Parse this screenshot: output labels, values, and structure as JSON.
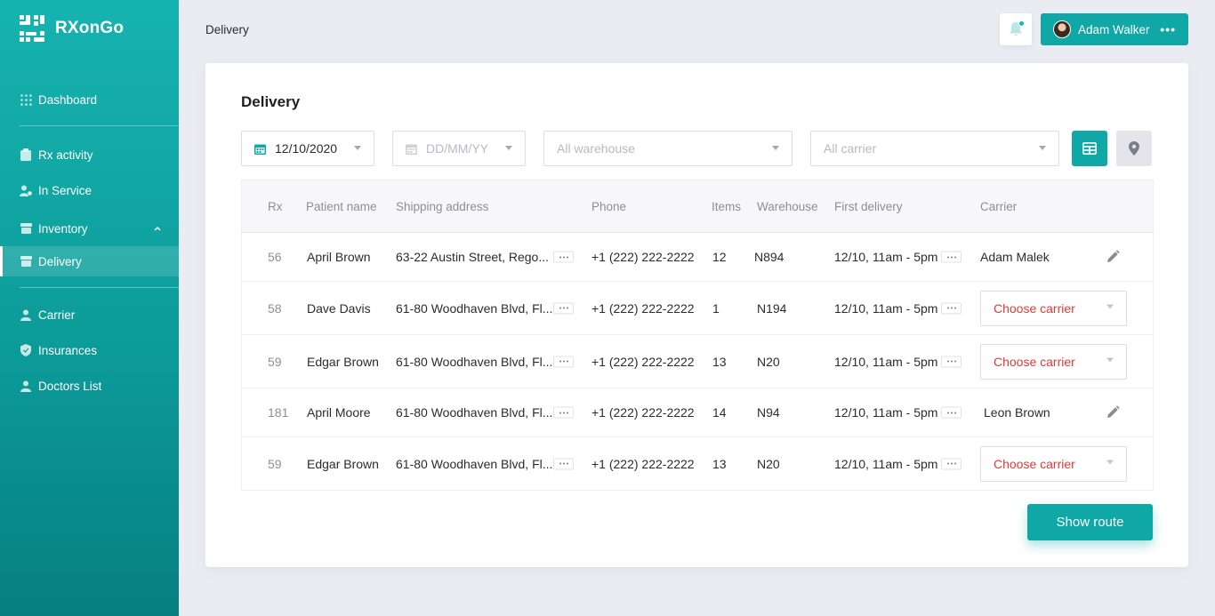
{
  "app": {
    "name": "RXonGo"
  },
  "sidebar": {
    "items": [
      {
        "label": "Dashboard",
        "icon": "grid-icon"
      },
      {
        "label": "Rx activity",
        "icon": "clipboard-icon"
      },
      {
        "label": "In Service",
        "icon": "user-gear-icon"
      },
      {
        "label": "Inventory",
        "icon": "box-icon",
        "expanded": true
      },
      {
        "label": "Delivery",
        "icon": "box-icon",
        "active": true
      },
      {
        "label": "Carrier",
        "icon": "user-icon"
      },
      {
        "label": "Insurances",
        "icon": "shield-icon"
      },
      {
        "label": "Doctors List",
        "icon": "user-icon"
      }
    ]
  },
  "header": {
    "breadcrumb": "Delivery",
    "user": {
      "name": "Adam Walker"
    }
  },
  "main": {
    "title": "Delivery",
    "filters": {
      "date_from": "12/10/2020",
      "date_to_placeholder": "DD/MM/YY",
      "warehouse_placeholder": "All warehouse",
      "carrier_placeholder": "All carrier"
    },
    "table": {
      "columns": [
        "Rx",
        "Patient name",
        "Shipping address",
        "Phone",
        "Items",
        "Warehouse",
        "First delivery",
        "Carrier"
      ],
      "rows": [
        {
          "rx": "56",
          "patient": "April Brown",
          "address": "63-22 Austin Street, Rego...",
          "phone": "+1 (222) 222-2222",
          "items": "12",
          "warehouse": "N894",
          "first_delivery": "12/10, 11am - 5pm",
          "carrier": "Adam Malek",
          "carrier_assigned": true
        },
        {
          "rx": "58",
          "patient": "Dave Davis",
          "address": "61-80 Woodhaven Blvd, Fl...",
          "phone": "+1 (222) 222-2222",
          "items": "1",
          "warehouse": "N194",
          "first_delivery": "12/10, 11am - 5pm",
          "carrier": "Choose carrier",
          "carrier_assigned": false
        },
        {
          "rx": "59",
          "patient": "Edgar Brown",
          "address": "61-80 Woodhaven Blvd, Fl...",
          "phone": "+1 (222) 222-2222",
          "items": "13",
          "warehouse": "N20",
          "first_delivery": "12/10, 11am - 5pm",
          "carrier": "Choose carrier",
          "carrier_assigned": false
        },
        {
          "rx": "181",
          "patient": "April Moore",
          "address": "61-80 Woodhaven Blvd, Fl...",
          "phone": "+1 (222) 222-2222",
          "items": "14",
          "warehouse": "N94",
          "first_delivery": "12/10, 11am - 5pm",
          "carrier": "Leon Brown",
          "carrier_assigned": true
        },
        {
          "rx": "59",
          "patient": "Edgar Brown",
          "address": "61-80 Woodhaven Blvd, Fl...",
          "phone": "+1 (222) 222-2222",
          "items": "13",
          "warehouse": "N20",
          "first_delivery": "12/10, 11am - 5pm",
          "carrier": "Choose carrier",
          "carrier_assigned": false
        }
      ]
    },
    "show_route_label": "Show route"
  },
  "colors": {
    "accent": "#0fa8a6",
    "warning_text": "#e03a3a",
    "sidebar_top": "#16b3b0",
    "sidebar_bottom": "#077f80"
  }
}
